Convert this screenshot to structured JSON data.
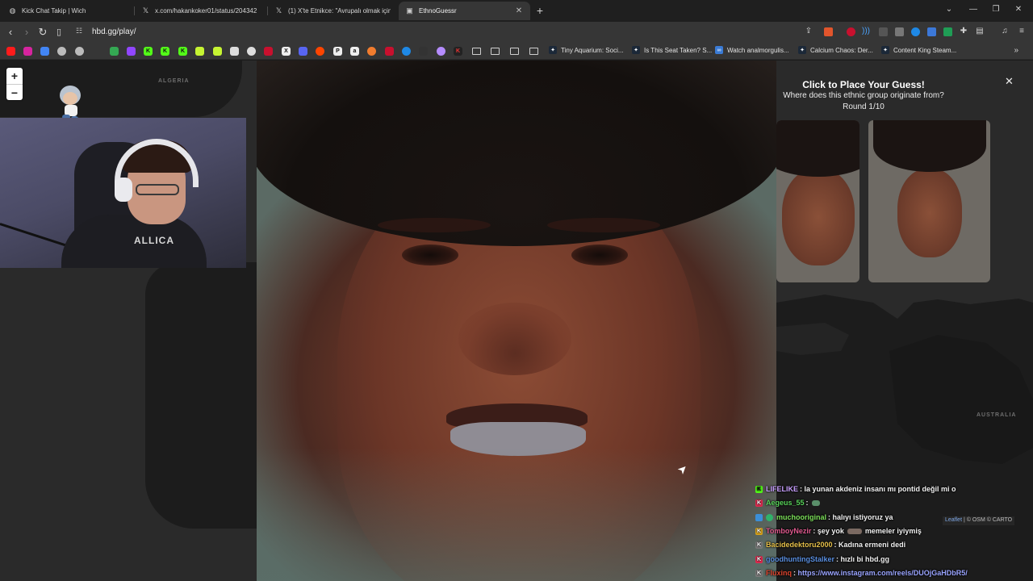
{
  "tabs": [
    {
      "title": "Kick Chat Takip | Wich",
      "icon": "globe-icon"
    },
    {
      "title": "x.com/hakankoker01/status/204342",
      "icon": "x-logo-icon"
    },
    {
      "title": "(1) X'te Etnikce: \"Avrupalı olmak için",
      "icon": "x-logo-icon"
    },
    {
      "title": "EthnoGuessr",
      "icon": "ethnoguessr-favicon"
    }
  ],
  "address_bar": {
    "url": "hbd.gg/play/"
  },
  "bookmarks": [
    {
      "label": "Tiny Aquarium: Soci...",
      "icon": "steam-icon"
    },
    {
      "label": "Is This Seat Taken? S...",
      "icon": "steam-icon"
    },
    {
      "label": "Watch analmorgulis...",
      "icon": "watch-icon"
    },
    {
      "label": "Calcium Chaos: Der...",
      "icon": "steam-icon"
    },
    {
      "label": "Content King Steam...",
      "icon": "steam-icon"
    }
  ],
  "map": {
    "labels": {
      "algeria": "ALGERIA",
      "australia": "AUSTRALIA"
    },
    "zoom_in": "+",
    "zoom_out": "−",
    "attribution": {
      "leaflet": "Leaflet",
      "rest": "| © OSM © CARTO"
    }
  },
  "webcam": {
    "shirt_text": "ALLICA"
  },
  "guess_panel": {
    "title": "Click to Place Your Guess!",
    "question": "Where does this ethnic group originate from?",
    "round": "Round 1/10",
    "close": "✕"
  },
  "chat": [
    {
      "badge": "K",
      "badge_color": "#53fc18",
      "user": "LIFELIKE",
      "user_color": "#c9a0ff",
      "message": "la yunan akdeniz insanı mı pontid değil mi o"
    },
    {
      "badge": "K",
      "badge_color": "#e02a4f",
      "user": "Aegeus_55",
      "user_color": "#58d35a",
      "message": ":",
      "emote": true
    },
    {
      "badge": "",
      "badge_color": "#3b8fd8",
      "user": "muchooriginal",
      "user_color": "#7ce05a",
      "message": "halıyı istiyoruz ya"
    },
    {
      "badge": "K",
      "badge_color": "#d7a21b",
      "user": "TomboyNezir",
      "user_color": "#e05a8f",
      "message": "şey yok",
      "emote": true,
      "message2": "memeler iyiymiş"
    },
    {
      "badge": "K",
      "badge_color": "#7a7a7a",
      "user": "Bacidedektoru2000",
      "user_color": "#e6c04a",
      "message": "Kadına ermeni dedi"
    },
    {
      "badge": "K",
      "badge_color": "#e02a4f",
      "user": "goodhuntingStalker",
      "user_color": "#5a8fe0",
      "message": "hızlı bi hbd.gg"
    },
    {
      "badge": "K",
      "badge_color": "#7a7a7a",
      "user": "Fluxinq",
      "user_color": "#e0452f",
      "message": "",
      "link": "https://www.instagram.com/reels/DUOjGaHDbR5/"
    }
  ],
  "colors": {
    "accent": "#53fc18",
    "panel_bg": "#2a2a2a",
    "map_land": "#1c1c1c"
  }
}
